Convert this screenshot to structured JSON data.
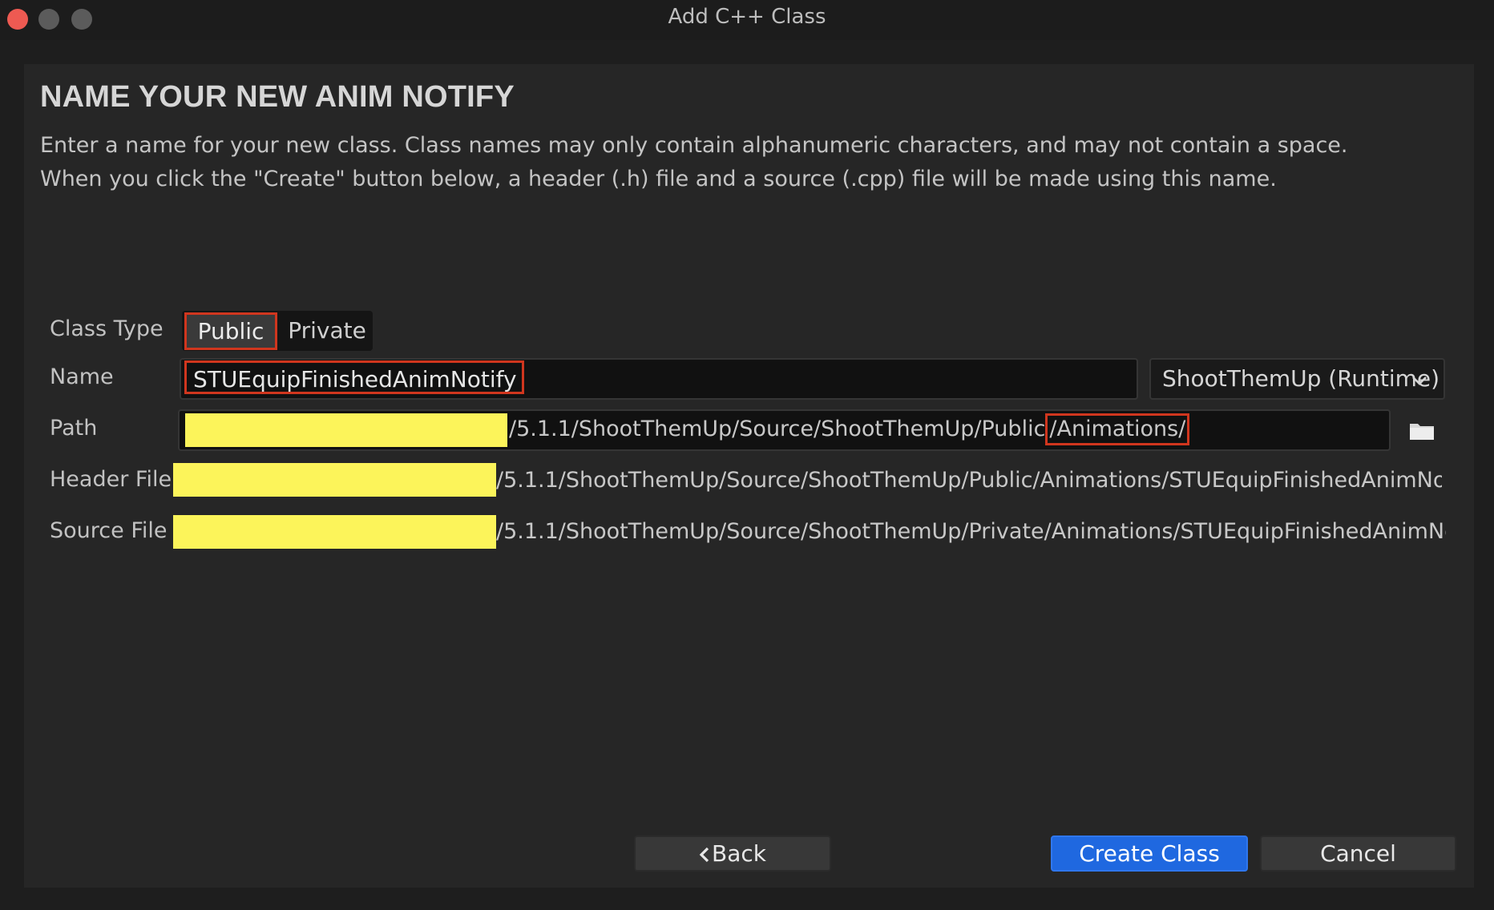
{
  "window": {
    "title": "Add C++ Class"
  },
  "page": {
    "heading": "NAME YOUR NEW ANIM NOTIFY",
    "description_line1": "Enter a name for your new class. Class names may only contain alphanumeric characters, and may not contain a space.",
    "description_line2": "When you click the \"Create\" button below, a header (.h) file and a source (.cpp) file will be made using this name."
  },
  "form": {
    "class_type": {
      "label": "Class Type",
      "options": [
        "Public",
        "Private"
      ],
      "selected": "Public"
    },
    "name": {
      "label": "Name",
      "value": "STUEquipFinishedAnimNotify"
    },
    "module": {
      "selected": "ShootThemUp (Runtime)"
    },
    "path": {
      "label": "Path",
      "value_main": "/5.1.1/ShootThemUp/Source/ShootThemUp/Public",
      "value_highlight": "/Animations/"
    },
    "header_file": {
      "label": "Header File",
      "value": "/5.1.1/ShootThemUp/Source/ShootThemUp/Public/Animations/STUEquipFinishedAnimNotify.h"
    },
    "source_file": {
      "label": "Source File",
      "value": "/5.1.1/ShootThemUp/Source/ShootThemUp/Private/Animations/STUEquipFinishedAnimNotify.cpp"
    }
  },
  "buttons": {
    "back": "Back",
    "back_icon": "chevron-left-icon",
    "create": "Create Class",
    "cancel": "Cancel"
  },
  "icons": {
    "folder": "folder-icon",
    "dropdown": "chevron-down-icon"
  },
  "colors": {
    "accent": "#1f68e0",
    "highlight_border": "#d0361e",
    "redaction": "#fcf45a"
  }
}
